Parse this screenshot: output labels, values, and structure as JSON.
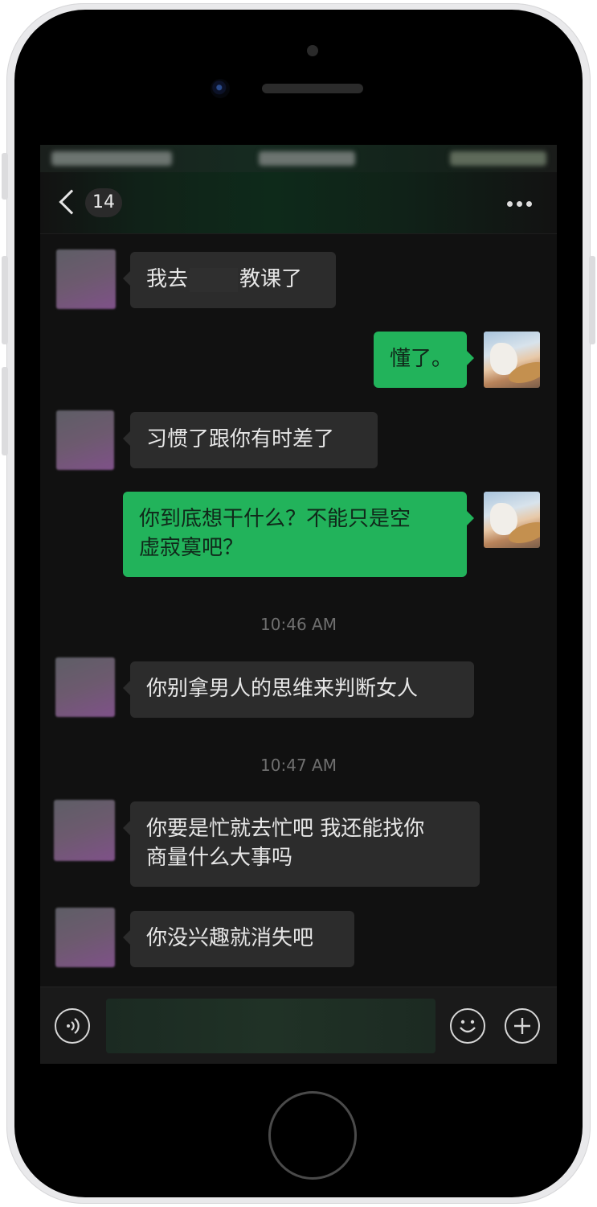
{
  "header": {
    "unread_count": "14"
  },
  "messages": [
    {
      "side": "left",
      "text_before": "我去",
      "text_after": "教课了"
    },
    {
      "side": "right",
      "text": "懂了。"
    },
    {
      "side": "left",
      "text": "习惯了跟你有时差了"
    },
    {
      "side": "right",
      "line1": "你到底想干什么？不能只是空",
      "line2": "虚寂寞吧？"
    },
    {
      "side": "left",
      "text": "你别拿男人的思维来判断女人"
    },
    {
      "side": "left",
      "line1": "你要是忙就去忙吧 我还能找你",
      "line2": "商量什么大事吗"
    },
    {
      "side": "left",
      "text": "你没兴趣就消失吧"
    }
  ],
  "timestamps": [
    "10:46 AM",
    "10:47 AM"
  ],
  "input_bar": {
    "voice_icon": "voice-icon",
    "emoji_icon": "emoji-icon",
    "add_icon": "plus-icon",
    "input_value": ""
  },
  "colors": {
    "sent_bubble": "#22b35b",
    "received_bubble": "#2c2c2c",
    "background": "#111111"
  }
}
